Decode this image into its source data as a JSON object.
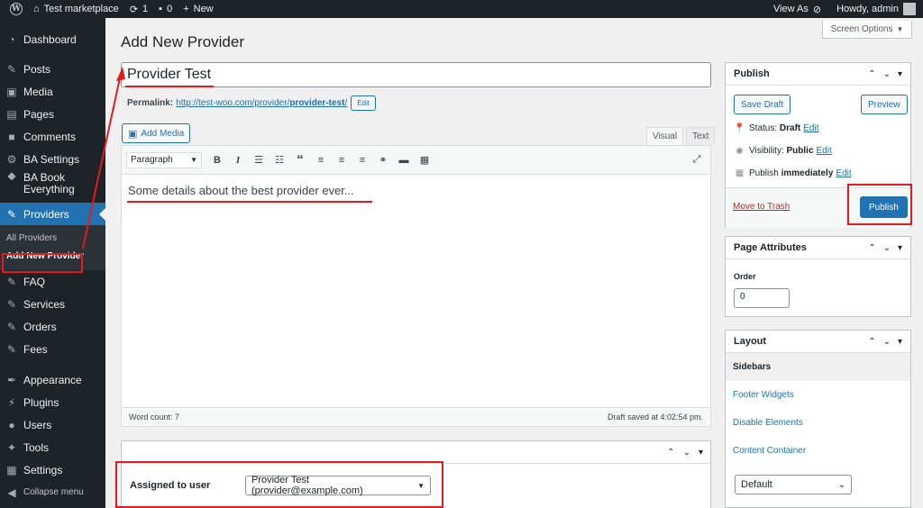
{
  "adminbar": {
    "site_name": "Test marketplace",
    "updates_count": "1",
    "comments_count": "0",
    "new_label": "New",
    "view_as": "View As",
    "howdy": "Howdy, admin"
  },
  "sidebar": {
    "items": [
      {
        "label": "Dashboard",
        "icon": "dashboard-icon",
        "glyph": "◔"
      },
      {
        "label": "Posts",
        "icon": "pin-icon",
        "glyph": "✎"
      },
      {
        "label": "Media",
        "icon": "media-icon",
        "glyph": "▣"
      },
      {
        "label": "Pages",
        "icon": "pages-icon",
        "glyph": "▤"
      },
      {
        "label": "Comments",
        "icon": "comment-icon",
        "glyph": "■"
      },
      {
        "label": "BA Settings",
        "icon": "gear-icon",
        "glyph": "⚙"
      },
      {
        "label": "BA Book Everything",
        "icon": "diamond-icon",
        "glyph": "◆"
      },
      {
        "label": "Providers",
        "icon": "pin-icon",
        "glyph": "✎"
      },
      {
        "label": "FAQ",
        "icon": "pin-icon",
        "glyph": "✎"
      },
      {
        "label": "Services",
        "icon": "pin-icon",
        "glyph": "✎"
      },
      {
        "label": "Orders",
        "icon": "pin-icon",
        "glyph": "✎"
      },
      {
        "label": "Fees",
        "icon": "pin-icon",
        "glyph": "✎"
      },
      {
        "label": "Appearance",
        "icon": "brush-icon",
        "glyph": "✒"
      },
      {
        "label": "Plugins",
        "icon": "plug-icon",
        "glyph": "⚡"
      },
      {
        "label": "Users",
        "icon": "user-icon",
        "glyph": "●"
      },
      {
        "label": "Tools",
        "icon": "wrench-icon",
        "glyph": "✦"
      },
      {
        "label": "Settings",
        "icon": "settings-icon",
        "glyph": "▦"
      },
      {
        "label": "Collapse menu",
        "icon": "collapse-icon",
        "glyph": "◀"
      }
    ],
    "submenu": [
      "All Providers",
      "Add New Provider"
    ]
  },
  "page": {
    "title": "Add New Provider",
    "screen_options": "Screen Options"
  },
  "post": {
    "title_value": "Provider Test",
    "permalink_label": "Permalink:",
    "permalink_base": "http://test-woo.com/provider/",
    "permalink_slug": "provider-test",
    "permalink_tail": "/",
    "permalink_edit": "Edit"
  },
  "editor": {
    "add_media": "Add Media",
    "tab_visual": "Visual",
    "tab_text": "Text",
    "format": "Paragraph",
    "content": "Some details about the best provider ever...",
    "word_count": "Word count: 7",
    "draft_saved": "Draft saved at 4:02:54 pm."
  },
  "assigned": {
    "label": "Assigned to user",
    "value": "Provider Test (provider@example.com)"
  },
  "publish": {
    "title": "Publish",
    "save_draft": "Save Draft",
    "preview": "Preview",
    "status_label": "Status:",
    "status_value": "Draft",
    "visibility_label": "Visibility:",
    "visibility_value": "Public",
    "publish_label": "Publish",
    "publish_value": "immediately",
    "edit": "Edit",
    "trash": "Move to Trash",
    "publish_button": "Publish"
  },
  "page_attributes": {
    "title": "Page Attributes",
    "order_label": "Order",
    "order_value": "0"
  },
  "layout": {
    "title": "Layout",
    "tabs": [
      "Sidebars",
      "Footer Widgets",
      "Disable Elements",
      "Content Container"
    ],
    "select_value": "Default"
  },
  "colors": {
    "accent": "#2271b1",
    "annotation": "#e31b1b",
    "sidebar_bg": "#1d2327"
  }
}
